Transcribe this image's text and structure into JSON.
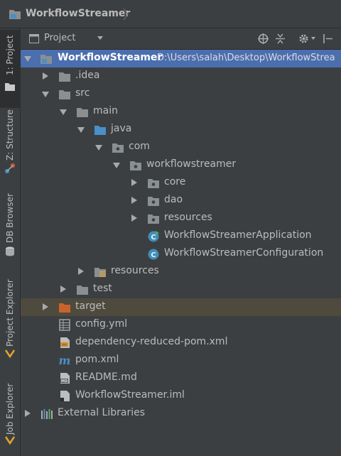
{
  "breadcrumb": {
    "project": "WorkflowStreamer"
  },
  "side_tabs": [
    {
      "label": "1: Project"
    },
    {
      "label": "Z: Structure"
    },
    {
      "label": "DB Browser"
    },
    {
      "label": "Project Explorer"
    },
    {
      "label": "Job Explorer"
    }
  ],
  "panel": {
    "view_label": "Project"
  },
  "tree": {
    "root": {
      "name": "WorkflowStreamer",
      "path": "D:\\Users\\salah\\Desktop\\WorkflowStrea"
    },
    "idea": ".idea",
    "src": "src",
    "main": "main",
    "java": "java",
    "com": "com",
    "pkg": "workflowstreamer",
    "core": "core",
    "dao": "dao",
    "resources_pkg": "resources",
    "app_class": "WorkflowStreamerApplication",
    "config_class": "WorkflowStreamerConfiguration",
    "resources_dir": "resources",
    "test": "test",
    "target": "target",
    "config_yml": "config.yml",
    "reduced_pom": "dependency-reduced-pom.xml",
    "pom": "pom.xml",
    "readme": "README.md",
    "iml": "WorkflowStreamer.iml",
    "ext_libs": "External Libraries"
  },
  "colors": {
    "background": "#3c3f41",
    "selection": "#4b6eaf",
    "excluded": "#4e4a3e",
    "folder": "#8a8f92",
    "source_folder": "#4a8fc7",
    "excluded_folder": "#c8642b"
  }
}
